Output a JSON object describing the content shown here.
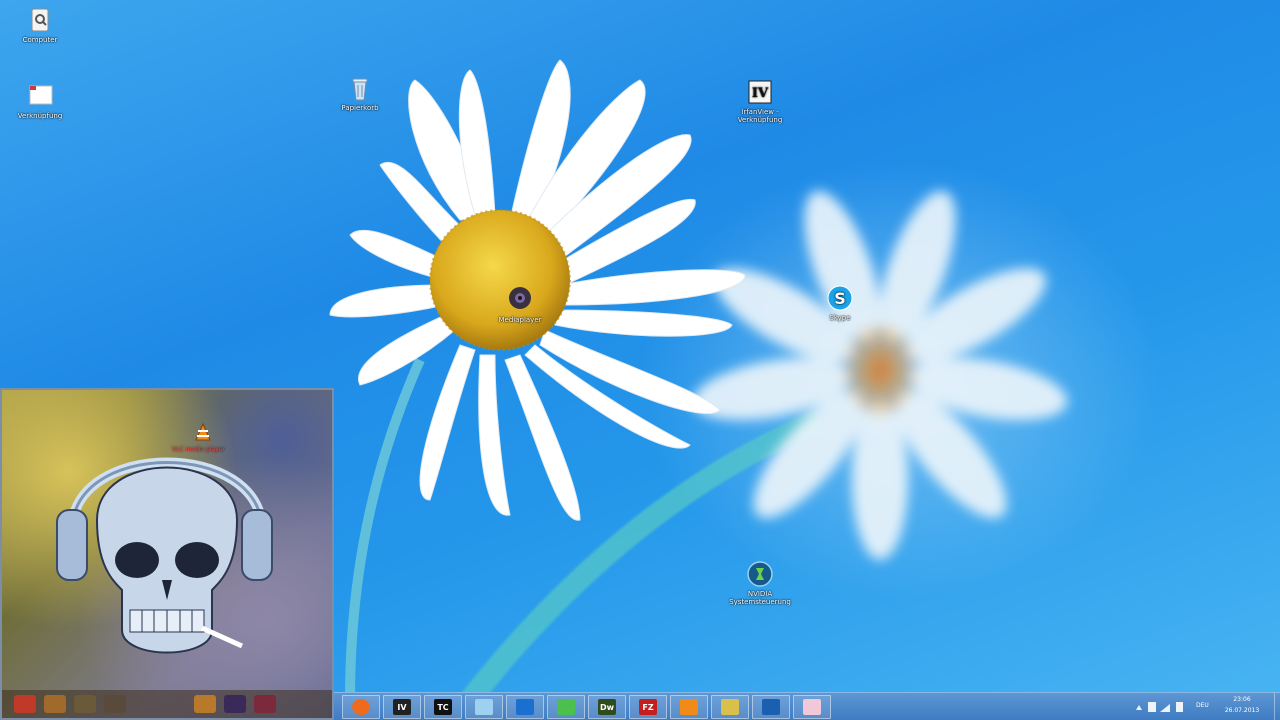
{
  "desktop": {
    "icons": [
      {
        "name": "computer-icon",
        "label": "Computer"
      },
      {
        "name": "folder-icon",
        "label": "Verknüpfung"
      },
      {
        "name": "recycle-bin-icon",
        "label": "Papierkorb"
      },
      {
        "name": "photo-viewer-icon",
        "label": "IrfanView - Verknüpfung"
      },
      {
        "name": "media-player-icon",
        "label": "Mediaplayer"
      },
      {
        "name": "skype-icon",
        "label": "Skype"
      },
      {
        "name": "nvidia-icon",
        "label": "NVIDIA Systemsteuerung"
      }
    ]
  },
  "inset": {
    "icon_label": "VLC media player"
  },
  "taskbar": {
    "apps": [
      {
        "name": "firefox-icon",
        "text": "",
        "color": "#f06a1e"
      },
      {
        "name": "irfanview-icon",
        "text": "IV",
        "color": "#222222"
      },
      {
        "name": "total-commander-icon",
        "text": "TC",
        "color": "#111111"
      },
      {
        "name": "file-manager-icon",
        "text": "",
        "color": "#9ed0f0"
      },
      {
        "name": "teamviewer-icon",
        "text": "",
        "color": "#1a6fd1"
      },
      {
        "name": "utorrent-icon",
        "text": "",
        "color": "#4cc04c"
      },
      {
        "name": "dreamweaver-icon",
        "text": "Dw",
        "color": "#2f4c1f"
      },
      {
        "name": "filezilla-icon",
        "text": "FZ",
        "color": "#c41f1f"
      },
      {
        "name": "vlc-icon",
        "text": "",
        "color": "#f08a18"
      },
      {
        "name": "python-icon",
        "text": "",
        "color": "#d8c04a"
      },
      {
        "name": "media-icon",
        "text": "",
        "color": "#1b5fb0"
      },
      {
        "name": "paint-icon",
        "text": "",
        "color": "#f0c8d8"
      }
    ],
    "tray": {
      "language": "DEU",
      "time": "23:06",
      "date": "26.07.2013"
    }
  }
}
